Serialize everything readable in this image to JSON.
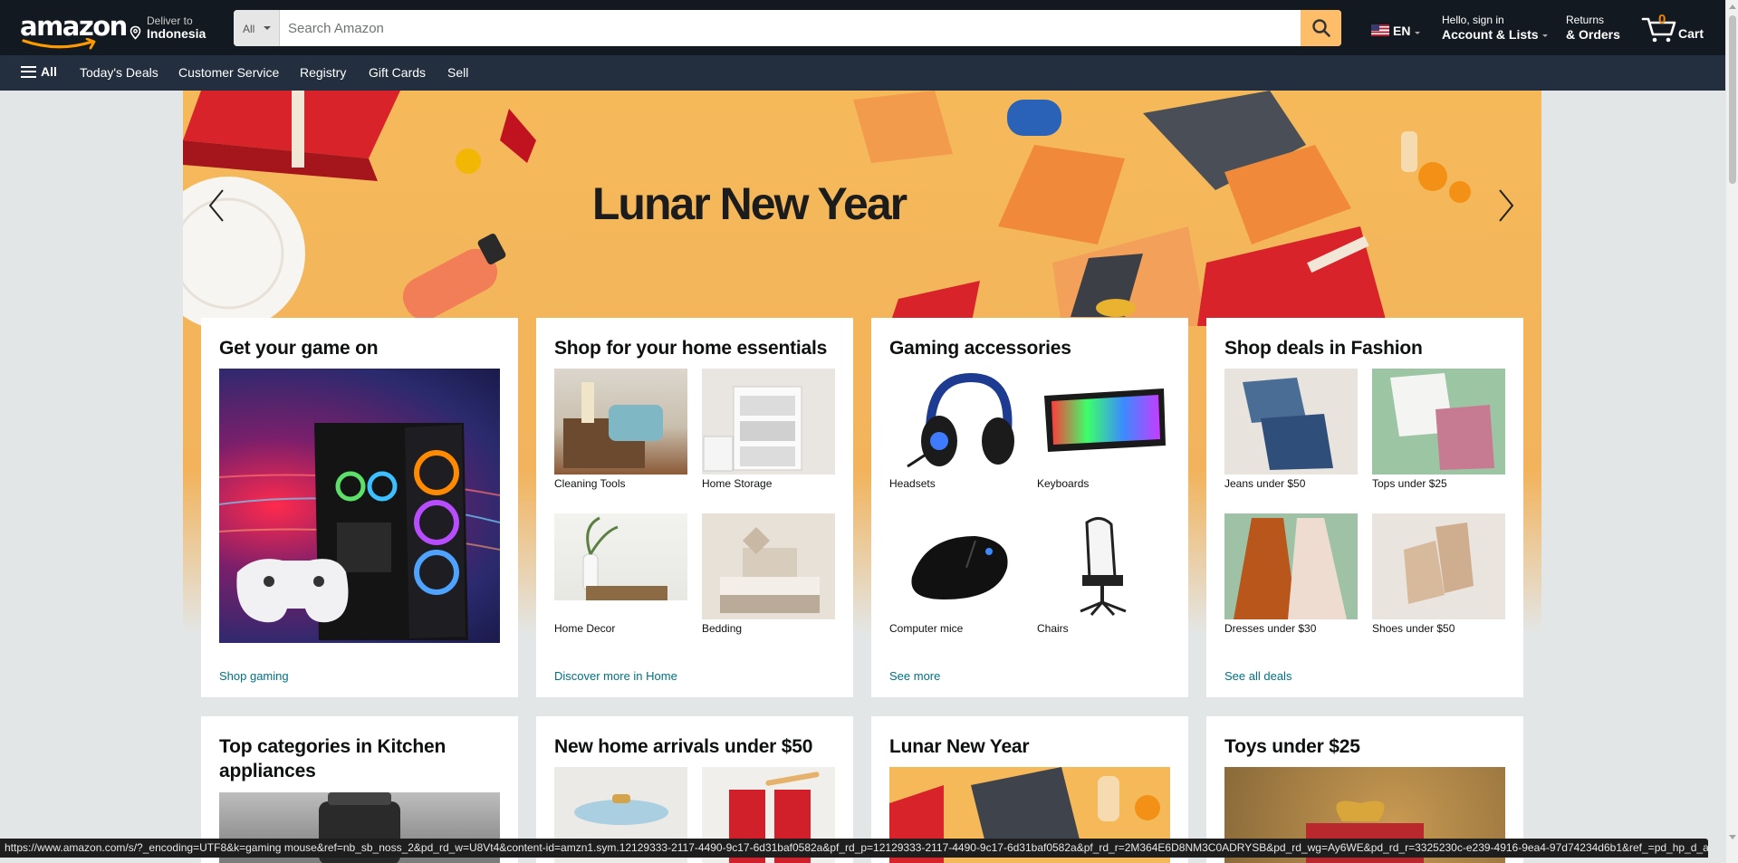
{
  "header": {
    "logo_text": "amazon",
    "deliver_line1": "Deliver to",
    "deliver_line2": "Indonesia",
    "search_dept": "All",
    "search_placeholder": "Search Amazon",
    "lang": "EN",
    "account_line1": "Hello, sign in",
    "account_line2": "Account & Lists",
    "orders_line1": "Returns",
    "orders_line2": "& Orders",
    "cart_count": "0",
    "cart_label": "Cart"
  },
  "nav": {
    "all_label": "All",
    "links": [
      "Today's Deals",
      "Customer Service",
      "Registry",
      "Gift Cards",
      "Sell"
    ]
  },
  "hero": {
    "title": "Lunar New Year"
  },
  "cards": [
    {
      "title": "Get your game on",
      "link": "Shop gaming"
    },
    {
      "title": "Shop for your home essentials",
      "link": "Discover more in Home",
      "tiles": [
        "Cleaning Tools",
        "Home Storage",
        "Home Decor",
        "Bedding"
      ]
    },
    {
      "title": "Gaming accessories",
      "link": "See more",
      "tiles": [
        "Headsets",
        "Keyboards",
        "Computer mice",
        "Chairs"
      ]
    },
    {
      "title": "Shop deals in Fashion",
      "link": "See all deals",
      "tiles": [
        "Jeans under $50",
        "Tops under $25",
        "Dresses under $30",
        "Shoes under $50"
      ]
    }
  ],
  "cards_row2": [
    {
      "title": "Top categories in Kitchen appliances"
    },
    {
      "title": "New home arrivals under $50"
    },
    {
      "title": "Lunar New Year"
    },
    {
      "title": "Toys under $25"
    }
  ],
  "status_url": "https://www.amazon.com/s/?_encoding=UTF8&k=gaming mouse&ref=nb_sb_noss_2&pd_rd_w=U8Vt4&content-id=amzn1.sym.12129333-2117-4490-9c17-6d31baf0582a&pf_rd_p=12129333-2117-4490-9c17-6d31baf0582a&pf_rd_r=2M364E6D8NM3C0ADRYSB&pd_rd_wg=Ay6WE&pd_rd_r=3325230c-e239-4916-9ea4-97d74234d6b1&ref_=pd_hp_d_a...",
  "colors": {
    "nav_belt": "#131921",
    "nav_main": "#232f3e",
    "search_button": "#febd69",
    "link": "#007185",
    "cart_count": "#f08804",
    "page_bg": "#e3e6e6",
    "hero_bg": "#f5b95a"
  }
}
